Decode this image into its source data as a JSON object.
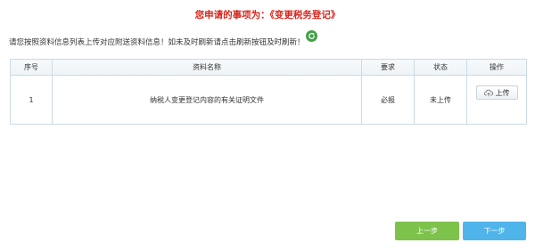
{
  "header": {
    "title": "您申请的事项为：《变更税务登记》"
  },
  "notice": {
    "text": "请您按照资料信息列表上传对应附送资料信息！如未及时刷新请点击刷新按钮及时刷新！"
  },
  "icons": {
    "refresh": "refresh-icon",
    "upload": "cloud-upload-icon"
  },
  "colors": {
    "title": "#d9251d",
    "refresh": "#43a047",
    "prev": "#7dc24b",
    "next": "#4fb4ea",
    "status_pending": "#d9251d"
  },
  "table": {
    "columns": [
      "序号",
      "资料名称",
      "要求",
      "状态",
      "操作"
    ],
    "rows": [
      {
        "index": "1",
        "name": "纳税人变更登记内容的有关证明文件",
        "requirement": "必报",
        "status": "未上传",
        "action": "上传"
      }
    ]
  },
  "footer": {
    "prev_label": "上一步",
    "next_label": "下一步"
  }
}
